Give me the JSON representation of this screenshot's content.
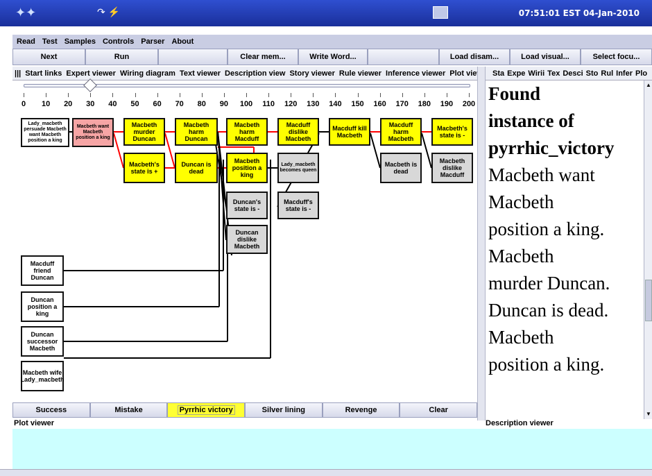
{
  "os": {
    "clock": "07:51:01 EST 04-Jan-2010"
  },
  "menu": [
    "Read",
    "Test",
    "Samples",
    "Controls",
    "Parser",
    "About"
  ],
  "toolbar": [
    {
      "label": "Next",
      "w": 105
    },
    {
      "label": "Run",
      "w": 105
    },
    {
      "label": "",
      "w": 100
    },
    {
      "label": "Clear mem...",
      "w": 102
    },
    {
      "label": "Write Word...",
      "w": 100
    },
    {
      "label": "",
      "w": 103
    },
    {
      "label": "Load disam...",
      "w": 102
    },
    {
      "label": "Load visual...",
      "w": 102
    },
    {
      "label": "Select focu...",
      "w": 103
    }
  ],
  "tabs_left": [
    "|||",
    "Start links",
    "Expert viewer",
    "Wiring diagram",
    "Text viewer",
    "Description view",
    "Story viewer",
    "Rule viewer",
    "Inference viewer",
    "Plot viewer"
  ],
  "tabs_right": [
    "Sta",
    "Expe",
    "Wirii",
    "Tex",
    "Desci",
    "Sto",
    "Rul",
    "Infer",
    "Plo"
  ],
  "slider": {
    "ticks": [
      "0",
      "10",
      "20",
      "30",
      "40",
      "50",
      "60",
      "70",
      "80",
      "90",
      "100",
      "110",
      "120",
      "130",
      "140",
      "150",
      "160",
      "170",
      "180",
      "190",
      "200"
    ],
    "value": 30
  },
  "nodes": [
    {
      "id": "n1",
      "text": "Lady_macbeth persuade Macbeth want Macbeth position a king",
      "color": "white",
      "small": true
    },
    {
      "id": "n2",
      "text": "Macbeth want Macbeth position a king",
      "color": "pink",
      "small": true
    },
    {
      "id": "n3",
      "text": "Macbeth murder Duncan",
      "color": "yellow"
    },
    {
      "id": "n4",
      "text": "Macbeth harm Duncan",
      "color": "yellow"
    },
    {
      "id": "n5",
      "text": "Macbeth harm Macduff",
      "color": "yellow"
    },
    {
      "id": "n6",
      "text": "Macduff dislike Macbeth",
      "color": "yellow"
    },
    {
      "id": "n7",
      "text": "Macduff kill Macbeth",
      "color": "yellow"
    },
    {
      "id": "n8",
      "text": "Macduff harm Macbeth",
      "color": "yellow"
    },
    {
      "id": "n9",
      "text": "Macbeth's state is -",
      "color": "yellow"
    },
    {
      "id": "n10",
      "text": "Macbeth's state is +",
      "color": "yellow"
    },
    {
      "id": "n11",
      "text": "Duncan is dead",
      "color": "yellow"
    },
    {
      "id": "n12",
      "text": "Macbeth position a king",
      "color": "yellow"
    },
    {
      "id": "n13",
      "text": "Lady_macbeth becomes queen",
      "color": "gray",
      "small": true
    },
    {
      "id": "n14",
      "text": "Macbeth is dead",
      "color": "gray"
    },
    {
      "id": "n15",
      "text": "Macbeth dislike Macduff",
      "color": "gray"
    },
    {
      "id": "n16",
      "text": "Duncan's state is -",
      "color": "gray"
    },
    {
      "id": "n17",
      "text": "Macduff's state is -",
      "color": "gray"
    },
    {
      "id": "n18",
      "text": "Duncan dislike Macbeth",
      "color": "gray"
    },
    {
      "id": "n19",
      "text": "Macduff friend Duncan",
      "color": "white"
    },
    {
      "id": "n20",
      "text": "Duncan position a king",
      "color": "white"
    },
    {
      "id": "n21",
      "text": "Duncan successor Macbeth",
      "color": "white"
    },
    {
      "id": "n22",
      "text": "Macbeth wife Lady_macbeth",
      "color": "white"
    }
  ],
  "bottom_buttons": [
    {
      "label": "Success",
      "active": false
    },
    {
      "label": "Mistake",
      "active": false
    },
    {
      "label": "Pyrrhic victory",
      "active": true
    },
    {
      "label": "Silver lining",
      "active": false
    },
    {
      "label": "Revenge",
      "active": false
    },
    {
      "label": "Clear",
      "active": false
    }
  ],
  "labels": {
    "plot_viewer": "Plot viewer",
    "description_viewer": "Description viewer"
  },
  "description": {
    "heading": [
      "Found",
      "instance of",
      "pyrrhic_victory"
    ],
    "lines": [
      "Macbeth want",
      "Macbeth",
      "position a king.",
      "Macbeth",
      "murder Duncan.",
      "Duncan is dead.",
      "Macbeth",
      "position a king."
    ]
  },
  "colors": {
    "yellow": "#ffff00",
    "pink": "#f6a5a5",
    "gray": "#d8d8d8",
    "red_link": "#ff0000",
    "active_button": "#ffff33",
    "bottom_panel": "#ccffff"
  }
}
